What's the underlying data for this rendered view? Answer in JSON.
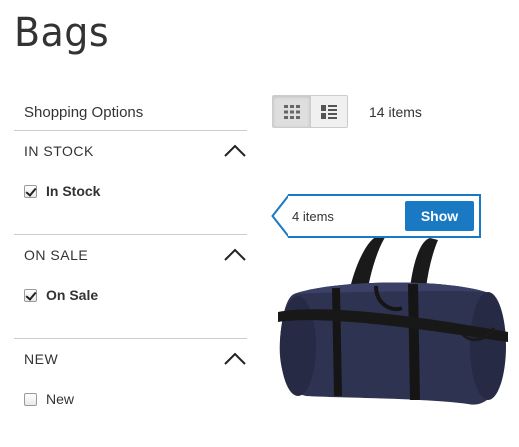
{
  "page": {
    "title": "Bags"
  },
  "sidebar": {
    "title": "Shopping Options",
    "filters": [
      {
        "title": "IN STOCK",
        "option": {
          "label": "In Stock",
          "checked": true,
          "bold": true
        }
      },
      {
        "title": "ON SALE",
        "option": {
          "label": "On Sale",
          "checked": true,
          "bold": true
        }
      },
      {
        "title": "NEW",
        "option": {
          "label": "New",
          "checked": false,
          "bold": false
        }
      }
    ]
  },
  "toolbar": {
    "grid_icon": "grid-icon",
    "list_icon": "list-icon",
    "count": "14 items"
  },
  "tooltip": {
    "count": "4 items",
    "button_label": "Show",
    "accent": "#1979c3"
  },
  "product": {
    "icon": "duffel-bag"
  }
}
